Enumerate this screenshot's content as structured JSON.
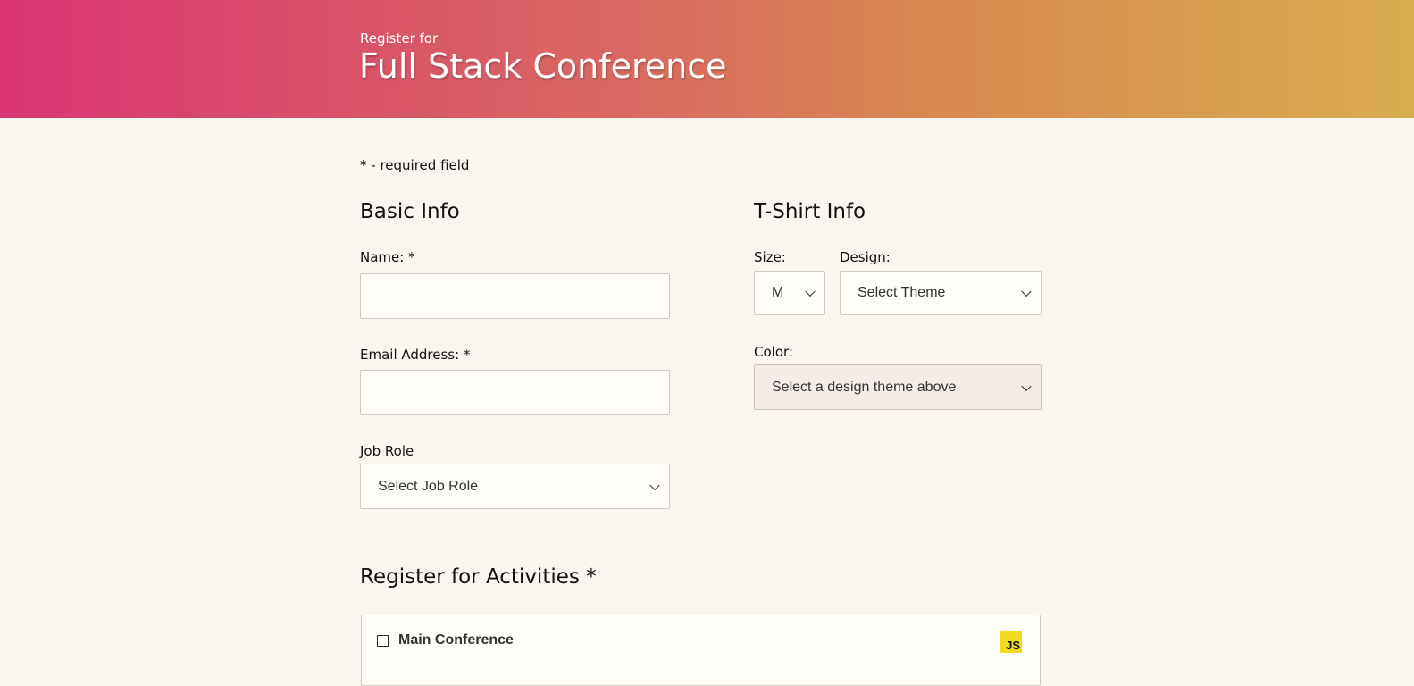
{
  "header": {
    "subtitle": "Register for",
    "title": "Full Stack Conference"
  },
  "required_note": "* - required field",
  "basic_info": {
    "heading": "Basic Info",
    "name_label": "Name: *",
    "name_value": "",
    "email_label": "Email Address: *",
    "email_value": "",
    "job_role_label": "Job Role",
    "job_role_selected": "Select Job Role"
  },
  "tshirt_info": {
    "heading": "T-Shirt Info",
    "size_label": "Size:",
    "size_selected": "M",
    "design_label": "Design:",
    "design_selected": "Select Theme",
    "color_label": "Color:",
    "color_selected": "Select a design theme above"
  },
  "activities": {
    "heading": "Register for Activities *",
    "items": [
      {
        "label": "Main Conference",
        "checked": false,
        "icon": "js-icon",
        "icon_text": "JS"
      }
    ]
  },
  "colors": {
    "header_gradient_start": "#d93574",
    "header_gradient_end": "#d9ac4f",
    "page_background": "#faf6ef",
    "js_badge": "#f0db1e"
  }
}
